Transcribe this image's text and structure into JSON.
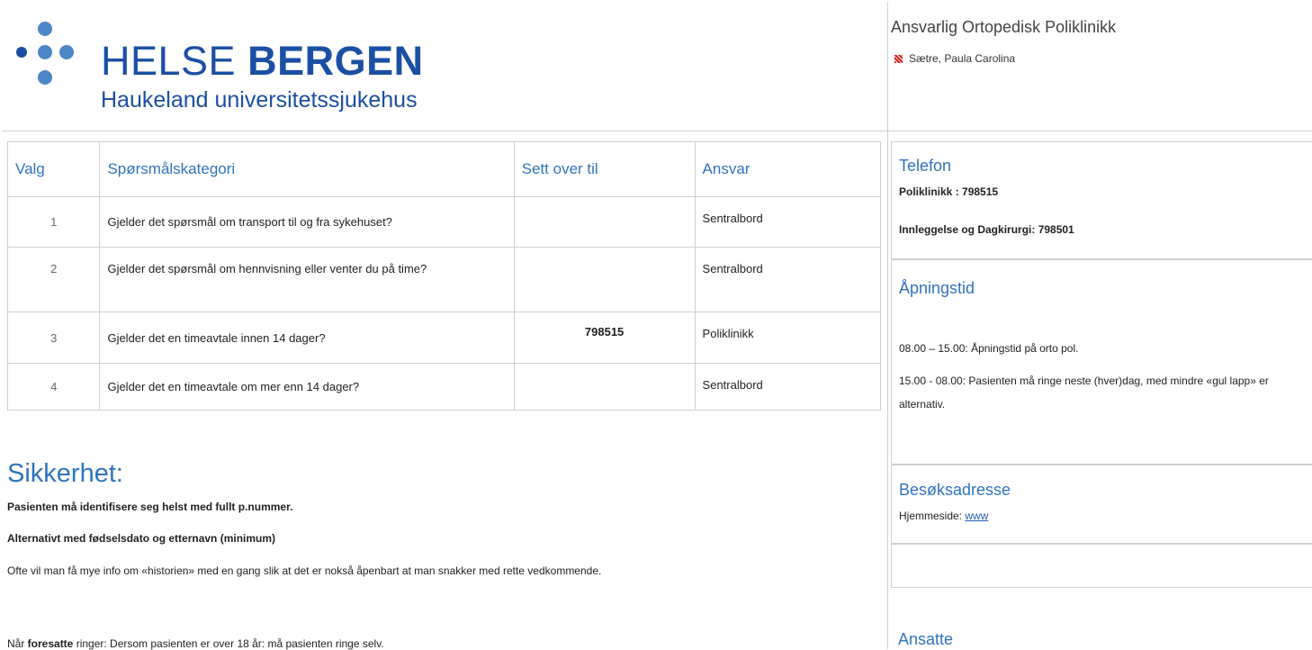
{
  "header": {
    "logo_brand_light": "HELSE",
    "logo_brand_bold": "BERGEN",
    "logo_subtitle": "Haukeland universitetssjukehus",
    "responsible_title": "Ansvarlig Ortopedisk Poliklinikk",
    "responsible_person": "Sætre, Paula Carolina"
  },
  "table": {
    "headers": [
      "Valg",
      "Spørsmålskategori",
      "Sett over til",
      "Ansvar"
    ],
    "rows": [
      {
        "num": "1",
        "category": "Gjelder det spørsmål om transport til og fra sykehuset?",
        "sett": "",
        "ansvar": "Sentralbord"
      },
      {
        "num": "2",
        "category": "Gjelder det  spørsmål om hennvisning eller venter du på time?",
        "sett": "",
        "ansvar": "Sentralbord"
      },
      {
        "num": "3",
        "category": "Gjelder det en timeavtale innen 14 dager?",
        "sett": "798515",
        "ansvar": "Poliklinikk"
      },
      {
        "num": "4",
        "category": "Gjelder det en timeavtale om mer enn 14 dager?",
        "sett": "",
        "ansvar": "Sentralbord"
      }
    ]
  },
  "security": {
    "title": "Sikkerhet:",
    "line1": "Pasienten må identifisere seg helst med fullt p.nummer.",
    "line2": "Alternativt med fødselsdato og etternavn (minimum)",
    "line3": "Ofte vil man få mye info om «historien» med en gang slik at det er nokså åpenbart at man snakker med rette vedkommende.",
    "line4_pre": "Når ",
    "line4_bold": "foresatte",
    "line4_post": " ringer: Dersom pasienten er over 18 år: må pasienten ringe selv."
  },
  "right": {
    "phone_title": "Telefon",
    "phone_line1": "Poliklinikk : 798515",
    "phone_line2": "Innleggelse og Dagkirurgi: 798501",
    "hours_title": "Åpningstid",
    "hours_line1": "08.00 – 15.00: Åpningstid på  orto pol.",
    "hours_line2a": "15.00 - 08.00: Pasienten må ringe neste (hver)dag, med mindre «gul lapp» er",
    "hours_line2b": "alternativ.",
    "address_title": "Besøksadresse",
    "homepage_label": "Hjemmeside: ",
    "homepage_link": "www",
    "staff_title": "Ansatte"
  },
  "colors": {
    "accent": "#2f74bd",
    "logo_blue": "#1b4fa3",
    "flag_red": "#d21f1f"
  }
}
